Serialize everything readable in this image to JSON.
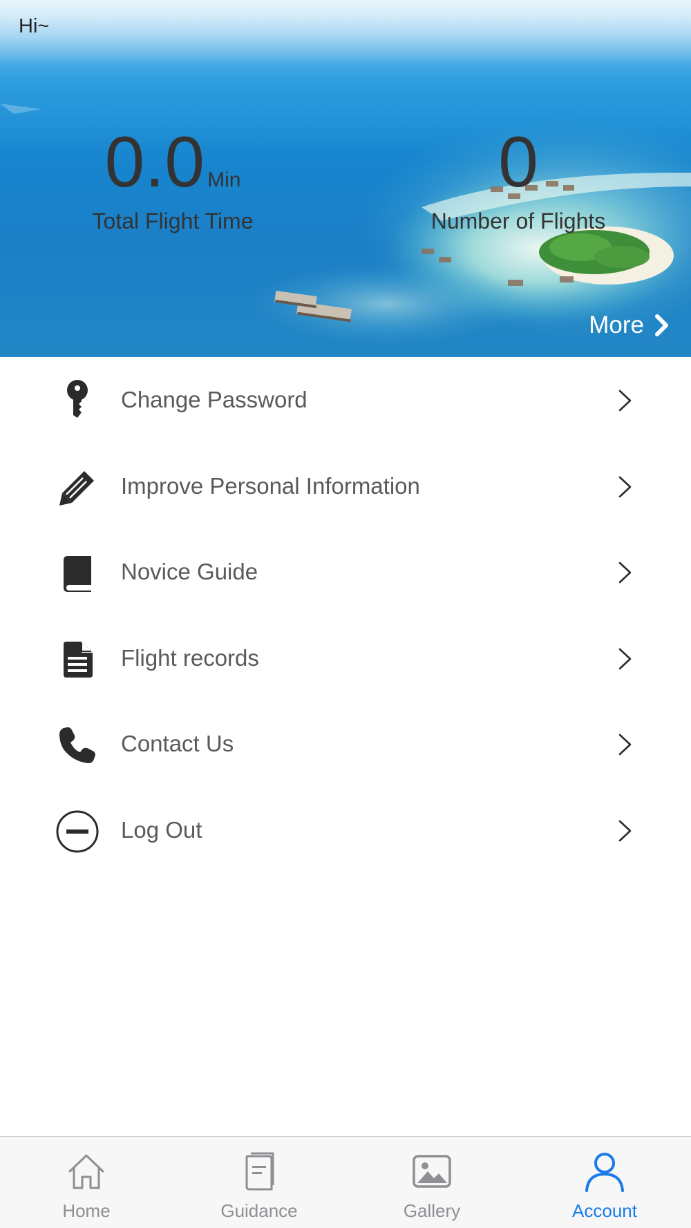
{
  "header": {
    "greeting": "Hi~",
    "more_label": "More"
  },
  "stats": {
    "total_flight_time": {
      "value": "0.0",
      "unit": "Min",
      "label": "Total Flight Time"
    },
    "number_of_flights": {
      "value": "0",
      "label": "Number of Flights"
    }
  },
  "menu": {
    "items": [
      {
        "label": "Change Password",
        "icon": "key-icon"
      },
      {
        "label": "Improve Personal Information",
        "icon": "pencil-icon"
      },
      {
        "label": "Novice Guide",
        "icon": "book-icon"
      },
      {
        "label": "Flight records",
        "icon": "document-icon"
      },
      {
        "label": "Contact Us",
        "icon": "phone-icon"
      },
      {
        "label": "Log Out",
        "icon": "minus-circle-icon"
      }
    ]
  },
  "tabbar": {
    "tabs": [
      {
        "label": "Home",
        "icon": "home-icon",
        "active": false
      },
      {
        "label": "Guidance",
        "icon": "guidance-icon",
        "active": false
      },
      {
        "label": "Gallery",
        "icon": "gallery-icon",
        "active": false
      },
      {
        "label": "Account",
        "icon": "account-icon",
        "active": true
      }
    ]
  },
  "colors": {
    "accent": "#1a7be8",
    "icon_dark": "#2b2b2b",
    "tab_inactive": "#8e8e93",
    "menu_text": "#5a5a5a"
  }
}
